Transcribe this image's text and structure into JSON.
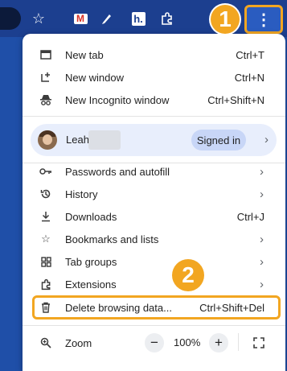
{
  "toolbar": {
    "icons": [
      "star-icon",
      "gmail-icon",
      "pen-icon",
      "h-extension-icon",
      "puzzle-icon"
    ],
    "h_ext_letter": "h.",
    "menu_button_glyph": "⋮"
  },
  "annotations": {
    "step1": "1",
    "step2": "2"
  },
  "menu": {
    "new_tab": {
      "label": "New tab",
      "shortcut": "Ctrl+T"
    },
    "new_window": {
      "label": "New window",
      "shortcut": "Ctrl+N"
    },
    "incognito": {
      "label": "New Incognito window",
      "shortcut": "Ctrl+Shift+N"
    },
    "profile": {
      "name": "Leah",
      "status": "Signed in"
    },
    "passwords": {
      "label": "Passwords and autofill"
    },
    "history": {
      "label": "History"
    },
    "downloads": {
      "label": "Downloads",
      "shortcut": "Ctrl+J"
    },
    "bookmarks": {
      "label": "Bookmarks and lists"
    },
    "tab_groups": {
      "label": "Tab groups"
    },
    "extensions": {
      "label": "Extensions"
    },
    "delete_data": {
      "label": "Delete browsing data...",
      "shortcut": "Ctrl+Shift+Del"
    },
    "zoom": {
      "label": "Zoom",
      "minus": "−",
      "value": "100%",
      "plus": "+"
    }
  },
  "colors": {
    "highlight": "#f2a621",
    "toolbar_bg": "#1c3f8f",
    "profile_bg": "#e8eefc",
    "signed_pill": "#c8d6f7"
  }
}
